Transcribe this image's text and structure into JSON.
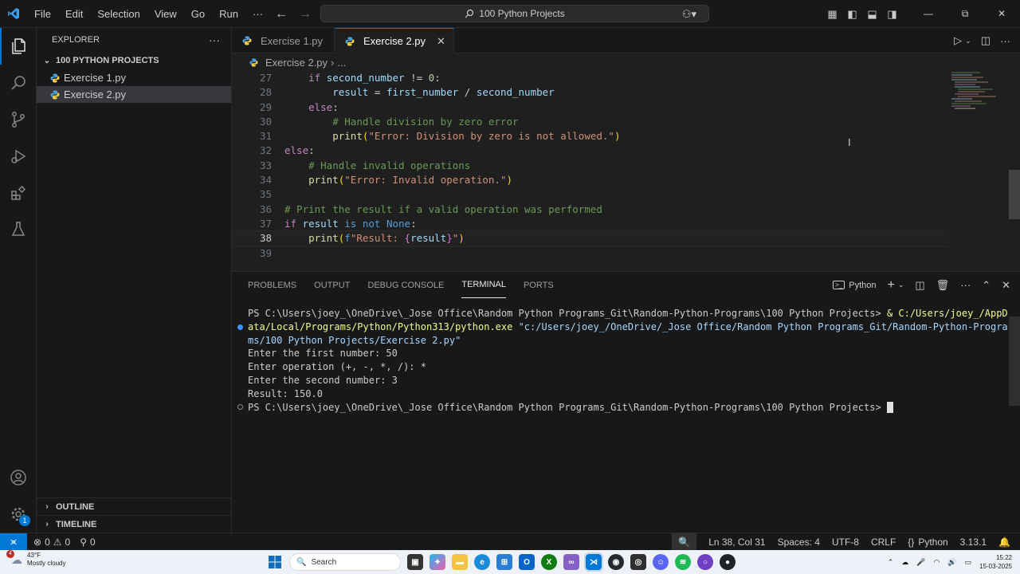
{
  "menu": [
    "File",
    "Edit",
    "Selection",
    "View",
    "Go",
    "Run",
    "···"
  ],
  "command_center": "100 Python Projects",
  "window_controls": [
    "—",
    "⧉",
    "✕"
  ],
  "explorer": {
    "title": "EXPLORER",
    "more": "···",
    "folder": "100 PYTHON PROJECTS",
    "files": [
      "Exercise 1.py",
      "Exercise 2.py"
    ],
    "outline": "OUTLINE",
    "timeline": "TIMELINE"
  },
  "tabs": [
    {
      "label": "Exercise 1.py",
      "active": false
    },
    {
      "label": "Exercise 2.py",
      "active": true
    }
  ],
  "breadcrumb": {
    "file": "Exercise 2.py",
    "rest": "..."
  },
  "code": {
    "line_numbers": [
      "27",
      "28",
      "29",
      "30",
      "31",
      "32",
      "33",
      "34",
      "35",
      "36",
      "37",
      "38",
      "39"
    ],
    "current_line": "38",
    "lines": [
      "    if second_number != 0:",
      "        result = first_number / second_number",
      "    else:",
      "        # Handle division by zero error",
      "        print(\"Error: Division by zero is not allowed.\")",
      "else:",
      "    # Handle invalid operations",
      "    print(\"Error: Invalid operation.\")",
      "",
      "# Print the result if a valid operation was performed",
      "if result is not None:",
      "    print(f\"Result: {result}\")",
      ""
    ]
  },
  "panel": {
    "tabs": [
      "PROBLEMS",
      "OUTPUT",
      "DEBUG CONSOLE",
      "TERMINAL",
      "PORTS"
    ],
    "active_tab": "TERMINAL",
    "shell": "Python",
    "terminal": {
      "prompt1": "PS C:\\Users\\joey_\\OneDrive\\_Jose Office\\Random Python Programs_Git\\Random-Python-Programs\\100 Python Projects> ",
      "cmd_exe": "& C:/Users/joey_/AppData/Local/Programs/Python/Python313/python.exe ",
      "cmd_arg": "\"c:/Users/joey_/OneDrive/_Jose Office/Random Python Programs_Git/Random-Python-Programs/100 Python Projects/Exercise 2.py\"",
      "output": [
        "Enter the first number: 50",
        "Enter operation (+, -, *, /): *",
        "Enter the second number: 3",
        "Result: 150.0"
      ],
      "prompt2": "PS C:\\Users\\joey_\\OneDrive\\_Jose Office\\Random Python Programs_Git\\Random-Python-Programs\\100 Python Projects> "
    }
  },
  "status": {
    "errors": "0",
    "warnings": "0",
    "ports": "0",
    "position": "Ln 38, Col 31",
    "spaces": "Spaces: 4",
    "encoding": "UTF-8",
    "eol": "CRLF",
    "language": "Python",
    "version": "3.13.1"
  },
  "taskbar": {
    "temp": "43°F",
    "weather": "Mostly cloudy",
    "weather_badge": "4",
    "search": "Search",
    "time": "15:22",
    "date": "15-03-2025"
  },
  "badge_settings": "1"
}
